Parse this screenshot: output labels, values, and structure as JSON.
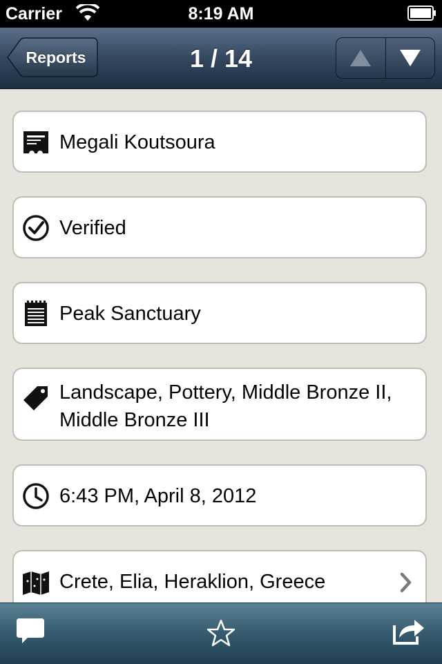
{
  "status_bar": {
    "carrier": "Carrier",
    "time": "8:19 AM"
  },
  "nav": {
    "back_label": "Reports",
    "title": "1 / 14"
  },
  "details": {
    "name": "Megali Koutsoura",
    "status": "Verified",
    "category": "Peak Sanctuary",
    "tags": "Landscape, Pottery, Middle Bronze II, Middle Bronze III",
    "datetime": "6:43 PM, April 8, 2012",
    "location": "Crete, Elia, Heraklion, Greece"
  },
  "icons": {
    "name": "ticket-icon",
    "status": "check-circle-icon",
    "category": "notepad-icon",
    "tags": "tag-icon",
    "datetime": "clock-icon",
    "location": "map-icon",
    "toolbar": [
      "comment-icon",
      "star-icon",
      "share-icon"
    ]
  },
  "colors": {
    "nav": "#34475f",
    "toolbar": "#355a6e",
    "background": "#e7e4de"
  }
}
